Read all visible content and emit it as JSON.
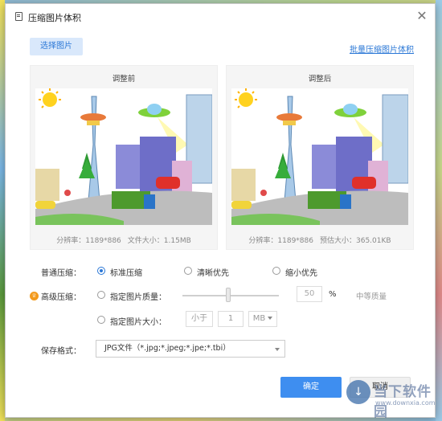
{
  "window": {
    "title": "压缩图片体积"
  },
  "toolbar": {
    "select_label": "选择图片",
    "batch_label": "批量压缩图片体积"
  },
  "before_panel": {
    "title": "调整前",
    "resolution": "分辨率：1189*886",
    "size": "文件大小：1.15MB"
  },
  "after_panel": {
    "title": "调整后",
    "resolution": "分辨率：1189*886",
    "size": "预估大小：365.01KB"
  },
  "normal": {
    "label": "普通压缩：",
    "options": [
      "标准压缩",
      "清晰优先",
      "缩小优先"
    ],
    "selected": 0
  },
  "advanced": {
    "label": "高级压缩：",
    "quality_label": "指定图片质量：",
    "quality_value": "50",
    "quality_unit": "%",
    "quality_level": "中等质量",
    "quality_fraction": 0.5,
    "size_label": "指定图片大小：",
    "size_compare": "小于",
    "size_value": "1",
    "size_unit": "MB"
  },
  "format": {
    "label": "保存格式：",
    "value": "JPG文件（*.jpg;*.jpeg;*.jpe;*.tbi）"
  },
  "buttons": {
    "ok": "确定",
    "cancel": "取消"
  },
  "watermark": {
    "text": "当下软件园",
    "url": "www.downxia.com"
  },
  "icons": {
    "app": "document-icon",
    "close": "close-icon",
    "vip": "vip-crown-icon",
    "dropdown": "chevron-down-icon"
  },
  "colors": {
    "accent": "#3e8ef0",
    "link": "#2a77d6",
    "vip": "#f39a1c"
  }
}
